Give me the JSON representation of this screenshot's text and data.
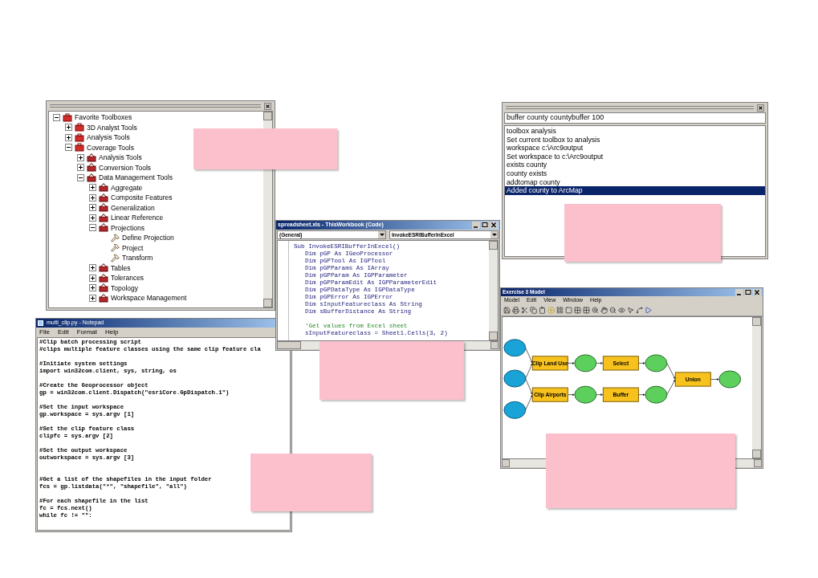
{
  "toolbox_window": {
    "tree": [
      {
        "label": "Favorite Toolboxes",
        "kind": "toolbox",
        "expanded": true,
        "children": [
          {
            "label": "3D Analyst Tools",
            "kind": "toolbox",
            "expanded": false
          },
          {
            "label": "Analysis Tools",
            "kind": "toolbox",
            "expanded": false
          },
          {
            "label": "Coverage Tools",
            "kind": "toolbox",
            "expanded": true,
            "children": [
              {
                "label": "Analysis Tools",
                "kind": "toolset",
                "expanded": false
              },
              {
                "label": "Conversion Tools",
                "kind": "toolset",
                "expanded": false
              },
              {
                "label": "Data Management Tools",
                "kind": "toolset",
                "expanded": true,
                "children": [
                  {
                    "label": "Aggregate",
                    "kind": "toolset",
                    "expanded": false
                  },
                  {
                    "label": "Composite Features",
                    "kind": "toolset",
                    "expanded": false
                  },
                  {
                    "label": "Generalization",
                    "kind": "toolset",
                    "expanded": false
                  },
                  {
                    "label": "Linear Reference",
                    "kind": "toolset",
                    "expanded": false
                  },
                  {
                    "label": "Projections",
                    "kind": "toolset",
                    "expanded": true,
                    "children": [
                      {
                        "label": "Define Projection",
                        "kind": "tool"
                      },
                      {
                        "label": "Project",
                        "kind": "tool"
                      },
                      {
                        "label": "Transform",
                        "kind": "tool"
                      }
                    ]
                  },
                  {
                    "label": "Tables",
                    "kind": "toolset",
                    "expanded": false
                  },
                  {
                    "label": "Tolerances",
                    "kind": "toolset",
                    "expanded": false
                  },
                  {
                    "label": "Topology",
                    "kind": "toolset",
                    "expanded": false
                  },
                  {
                    "label": "Workspace Management",
                    "kind": "toolset",
                    "expanded": false
                  }
                ]
              }
            ]
          }
        ]
      }
    ]
  },
  "notepad": {
    "title": "multi_clip.py - Notepad",
    "menu": [
      "File",
      "Edit",
      "Format",
      "Help"
    ],
    "blocks": [
      [
        "#Clip batch processing script",
        "#clips multiple feature classes using the same clip feature cla"
      ],
      [
        "#Initiate system settings",
        "import win32com.client, sys, string, os"
      ],
      [
        "#Create the Geoprocessor object",
        "gp = win32com.client.Dispatch(\"esriCore.GpDispatch.1\")"
      ],
      [
        "#Set the input workspace",
        "gp.workspace = sys.argv [1]"
      ],
      [
        "#Set the clip feature class",
        "clipfc = sys.argv [2]"
      ],
      [
        "#Set the output workspace",
        "outworkspace = sys.argv [3]"
      ],
      [
        "#Get a list of the shapefiles in the input folder",
        "fcs = gp.listdata(\"*\", \"shapefile\", \"all\")"
      ],
      [
        "#For each shapefile in the list",
        "fc = fcs.next()",
        "while fc != \"\":"
      ]
    ]
  },
  "vba": {
    "title": "spreadsheet.xls - ThisWorkbook (Code)",
    "object_dropdown": "(General)",
    "procedure_dropdown": "InvokeESRIBufferInExcel",
    "lines": [
      {
        "text": "Sub InvokeESRIBufferInExcel()",
        "kind": "header"
      },
      {
        "text": "Dim pGP As IGeoProcessor",
        "kind": "code"
      },
      {
        "text": "Dim pGPTool As IGPTool",
        "kind": "code"
      },
      {
        "text": "Dim pGPParams As IArray",
        "kind": "code"
      },
      {
        "text": "Dim pGPParam As IGPParameter",
        "kind": "code"
      },
      {
        "text": "Dim pGPParamEdit As IGPParameterEdit",
        "kind": "code"
      },
      {
        "text": "Dim pGPDataType As IGPDataType",
        "kind": "code"
      },
      {
        "text": "Dim pGPError As IGPError",
        "kind": "code"
      },
      {
        "text": "Dim sInputFeatureclass As String",
        "kind": "code"
      },
      {
        "text": "Dim sBufferDistance As String",
        "kind": "code"
      },
      {
        "text": "'Get values from Excel sheet",
        "kind": "comment"
      },
      {
        "text": "sInputFeatureclass = Sheet1.Cells(3, 2)",
        "kind": "code"
      }
    ]
  },
  "command_line": {
    "input": "buffer county countybuffer 100",
    "history": [
      {
        "text": "toolbox analysis",
        "selected": false
      },
      {
        "text": "Set current toolbox to analysis",
        "selected": false
      },
      {
        "text": "workspace c:\\Arc9output",
        "selected": false
      },
      {
        "text": "Set workspace to c:\\Arc9output",
        "selected": false
      },
      {
        "text": "exists county",
        "selected": false
      },
      {
        "text": "county exists",
        "selected": false
      },
      {
        "text": "addtomap county",
        "selected": false
      },
      {
        "text": "Added county to ArcMap",
        "selected": true
      }
    ]
  },
  "model": {
    "title": "Exercise 3 Model",
    "menu": [
      "Model",
      "Edit",
      "View",
      "Window",
      "Help"
    ],
    "nodes": [
      {
        "kind": "input"
      },
      {
        "kind": "input"
      },
      {
        "kind": "input"
      },
      {
        "kind": "tool",
        "label": "Clip Land Use"
      },
      {
        "kind": "tool",
        "label": "Clip Airports"
      },
      {
        "kind": "output"
      },
      {
        "kind": "output"
      },
      {
        "kind": "tool",
        "label": "Select"
      },
      {
        "kind": "tool",
        "label": "Buffer"
      },
      {
        "kind": "output"
      },
      {
        "kind": "output"
      },
      {
        "kind": "tool",
        "label": "Union"
      },
      {
        "kind": "output"
      }
    ]
  }
}
